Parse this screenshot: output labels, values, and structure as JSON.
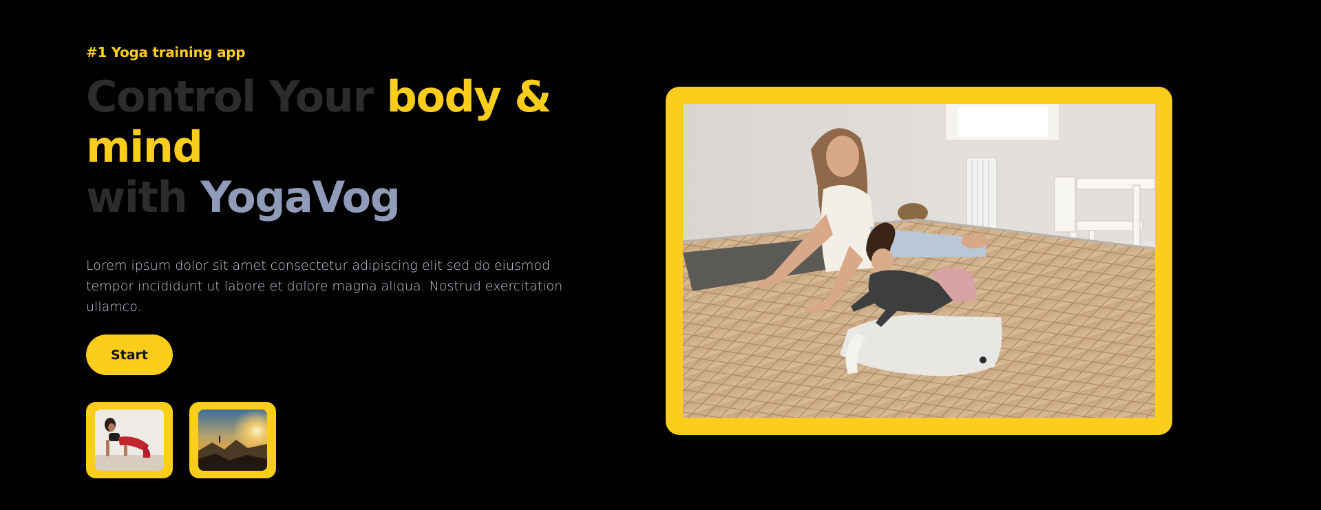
{
  "hero": {
    "eyebrow": "#1 Yoga training app",
    "headline": {
      "part1": "Control Your ",
      "part2": "body &",
      "part3": "mind",
      "part4": "with ",
      "part5": "YogaVog"
    },
    "description": "Lorem ipsum dolor sit amet consectetur adipiscing elit sed do eiusmod tempor incididunt ut labore et dolore magna aliqua. Nostrud exercitation ullamco.",
    "start_label": "Start"
  },
  "thumbnails": [
    {
      "subject": "woman-yoga-pose-photo"
    },
    {
      "subject": "mountain-sunset-photo"
    }
  ],
  "main_image": {
    "subject": "mother-child-yoga-photo"
  },
  "colors": {
    "background": "#000000",
    "accent": "#fcce1b",
    "headline_dim": "#2c2c2c",
    "brand": "#8f9bb8",
    "body_text": "#c6cbd9"
  }
}
